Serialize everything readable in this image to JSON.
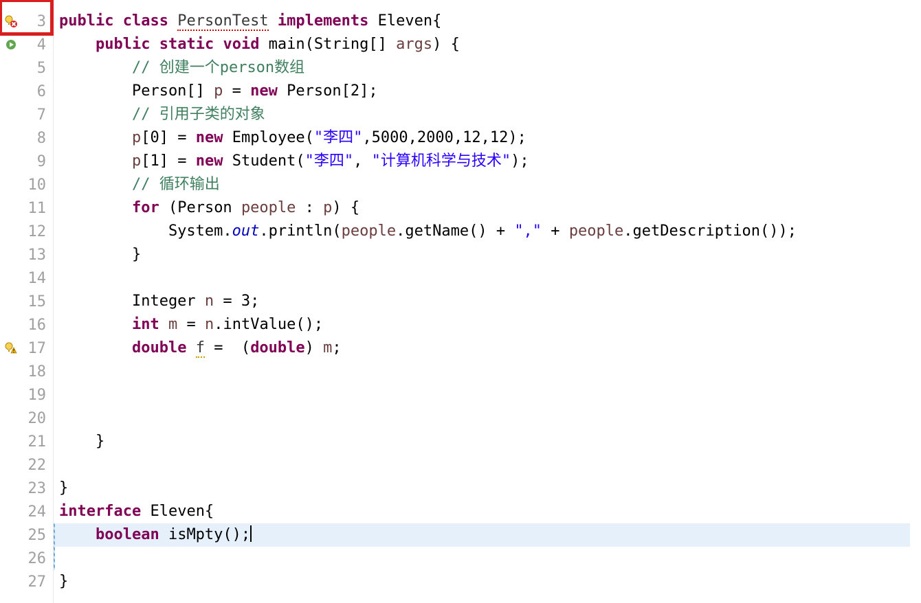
{
  "gutter": {
    "start": 3,
    "end": 27,
    "markers": {
      "3": "error",
      "4": "run",
      "17": "warn"
    }
  },
  "highlight_line": 25,
  "modified_lines": [
    25,
    26
  ],
  "code": {
    "3": [
      [
        "kw",
        "public"
      ],
      [
        "pln",
        " "
      ],
      [
        "kw",
        "class"
      ],
      [
        "pln",
        " "
      ],
      [
        "underline-red",
        "PersonTest"
      ],
      [
        "pln",
        " "
      ],
      [
        "kw",
        "implements"
      ],
      [
        "pln",
        " Eleven{"
      ]
    ],
    "4": [
      [
        "pln",
        "    "
      ],
      [
        "kw",
        "public"
      ],
      [
        "pln",
        " "
      ],
      [
        "kw",
        "static"
      ],
      [
        "pln",
        " "
      ],
      [
        "kw",
        "void"
      ],
      [
        "pln",
        " main(String[] "
      ],
      [
        "var-brown",
        "args"
      ],
      [
        "pln",
        ") {"
      ]
    ],
    "5": [
      [
        "pln",
        "        "
      ],
      [
        "cm",
        "// 创建一个person数组"
      ]
    ],
    "6": [
      [
        "pln",
        "        Person[] "
      ],
      [
        "var-brown",
        "p"
      ],
      [
        "pln",
        " = "
      ],
      [
        "kw",
        "new"
      ],
      [
        "pln",
        " Person[2];"
      ]
    ],
    "7": [
      [
        "pln",
        "        "
      ],
      [
        "cm",
        "// 引用子类的对象"
      ]
    ],
    "8": [
      [
        "pln",
        "        "
      ],
      [
        "var-brown",
        "p"
      ],
      [
        "pln",
        "[0] = "
      ],
      [
        "kw",
        "new"
      ],
      [
        "pln",
        " Employee("
      ],
      [
        "str",
        "\"李四\""
      ],
      [
        "pln",
        ",5000,2000,12,12);"
      ]
    ],
    "9": [
      [
        "pln",
        "        "
      ],
      [
        "var-brown",
        "p"
      ],
      [
        "pln",
        "[1] = "
      ],
      [
        "kw",
        "new"
      ],
      [
        "pln",
        " Student("
      ],
      [
        "str",
        "\"李四\""
      ],
      [
        "pln",
        ", "
      ],
      [
        "str",
        "\"计算机科学与技术\""
      ],
      [
        "pln",
        ");"
      ]
    ],
    "10": [
      [
        "pln",
        "        "
      ],
      [
        "cm",
        "// 循环输出"
      ]
    ],
    "11": [
      [
        "pln",
        "        "
      ],
      [
        "kw",
        "for"
      ],
      [
        "pln",
        " (Person "
      ],
      [
        "var-brown",
        "people"
      ],
      [
        "pln",
        " : "
      ],
      [
        "var-brown",
        "p"
      ],
      [
        "pln",
        ") {"
      ]
    ],
    "12": [
      [
        "pln",
        "            System."
      ],
      [
        "id-italic",
        "out"
      ],
      [
        "pln",
        ".println("
      ],
      [
        "var-brown",
        "people"
      ],
      [
        "pln",
        ".getName() + "
      ],
      [
        "str",
        "\",\""
      ],
      [
        "pln",
        " + "
      ],
      [
        "var-brown",
        "people"
      ],
      [
        "pln",
        ".getDescription());"
      ]
    ],
    "13": [
      [
        "pln",
        "        }"
      ]
    ],
    "14": [
      [
        "pln",
        ""
      ]
    ],
    "15": [
      [
        "pln",
        "        Integer "
      ],
      [
        "var-brown",
        "n"
      ],
      [
        "pln",
        " = 3;"
      ]
    ],
    "16": [
      [
        "pln",
        "        "
      ],
      [
        "kw",
        "int"
      ],
      [
        "pln",
        " "
      ],
      [
        "var-brown",
        "m"
      ],
      [
        "pln",
        " = "
      ],
      [
        "var-brown",
        "n"
      ],
      [
        "pln",
        ".intValue();"
      ]
    ],
    "17": [
      [
        "pln",
        "        "
      ],
      [
        "kw",
        "double"
      ],
      [
        "pln",
        " "
      ],
      [
        "underline-yellow",
        "f"
      ],
      [
        "pln",
        " =  ("
      ],
      [
        "kw",
        "double"
      ],
      [
        "pln",
        ") "
      ],
      [
        "var-brown",
        "m"
      ],
      [
        "pln",
        ";"
      ]
    ],
    "18": [
      [
        "pln",
        ""
      ]
    ],
    "19": [
      [
        "pln",
        ""
      ]
    ],
    "20": [
      [
        "pln",
        ""
      ]
    ],
    "21": [
      [
        "pln",
        "    }"
      ]
    ],
    "22": [
      [
        "pln",
        ""
      ]
    ],
    "23": [
      [
        "pln",
        "}"
      ]
    ],
    "24": [
      [
        "kw",
        "interface"
      ],
      [
        "pln",
        " Eleven{"
      ]
    ],
    "25": [
      [
        "pln",
        "    "
      ],
      [
        "kw",
        "boolean"
      ],
      [
        "pln",
        " isMpty();"
      ],
      [
        "caret",
        ""
      ]
    ],
    "26": [
      [
        "pln",
        ""
      ]
    ],
    "27": [
      [
        "pln",
        "}"
      ]
    ]
  }
}
